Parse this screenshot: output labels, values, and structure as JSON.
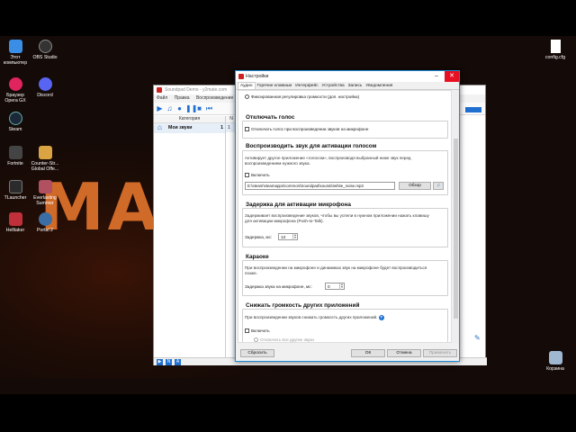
{
  "desktop": {
    "wallpaper_text": "MA",
    "icons": [
      {
        "label": "Этот компьютер",
        "color": "#3a8ee6"
      },
      {
        "label": "OBS Studio",
        "color": "#333333"
      },
      {
        "label": "Браузер Opera GX",
        "color": "#e0245e"
      },
      {
        "label": "Discord",
        "color": "#5865f2"
      },
      {
        "label": "Steam",
        "color": "#1b2838"
      },
      {
        "label": "Fortnite",
        "color": "#444444"
      },
      {
        "label": "Counter-Str... Global Offe...",
        "color": "#d9a441"
      },
      {
        "label": "TLauncher",
        "color": "#2b2b2b"
      },
      {
        "label": "Everlasting Summer",
        "color": "#b05060"
      },
      {
        "label": "Helltaker",
        "color": "#c0303a"
      },
      {
        "label": "Portal 2",
        "color": "#3a6ea5"
      },
      {
        "label": "config.cfg",
        "color": "#ffffff"
      },
      {
        "label": "Корзина",
        "color": "#9fb7d0"
      }
    ]
  },
  "soundpad": {
    "title": "Soundpad Demo - y2mate.com",
    "menu": [
      "Файл",
      "Правка",
      "Воспроизведение"
    ],
    "category_header": "Категория",
    "category_item": "Мои звуки",
    "category_count": "1",
    "number_header": "N",
    "number_value": "1",
    "bottom_buttons": [
      "N",
      "A"
    ]
  },
  "dialog": {
    "title": "Настройки",
    "tabs": [
      "Аудио",
      "Горячие клавиши",
      "Интерфейс",
      "Устройства",
      "Запись",
      "Уведомления"
    ],
    "active_tab": "Аудио",
    "fixed_volume_radio": "Фиксированная регулировка громкости (доп. настройка)",
    "mute_voice": {
      "title": "Отключать голос",
      "checkbox": "Отключать голос при воспроизведении звуков на микрофоне"
    },
    "activation_sound": {
      "title": "Воспроизводить звук для активации голосом",
      "description": "Активирует другое приложение «голосом», воспроизводя выбранный ниже звук перед воспроизведением нужного звука.",
      "checkbox": "Включить",
      "path": "E:\\steam\\steamapps\\common\\Soundpad\\sounds\\white_noise.mp3",
      "browse_button": "Обзор"
    },
    "mic_delay": {
      "title": "Задержка для активации микрофона",
      "description": "Задерживает воспроизведение звуков, чтобы вы успели в нужном приложении нажать клавишу для активации микрофона (Push-to-Talk).",
      "delay_label": "Задержка, мс:",
      "delay_value": "13"
    },
    "karaoke": {
      "title": "Караоке",
      "description": "При воспроизведении на микрофоне и динамиках звук на микрофоне будет воспроизводиться позже.",
      "delay_label": "Задержка звука на микрофоне, мс:",
      "delay_value": "0"
    },
    "lower_volume": {
      "title": "Снижать громкость других приложений",
      "description": "При воспроизведении звуков снижать громкость других приложений.",
      "checkbox": "Включить",
      "sub_checkbox": "Отключать все другие звуки"
    },
    "footer": {
      "reset": "Сбросить",
      "ok": "ОК",
      "cancel": "Отмена",
      "apply": "Применить"
    }
  },
  "colors": {
    "accent": "#1e6fd0",
    "dialog_border": "#1b8cd6",
    "wallpaper_text": "#d06a28"
  }
}
